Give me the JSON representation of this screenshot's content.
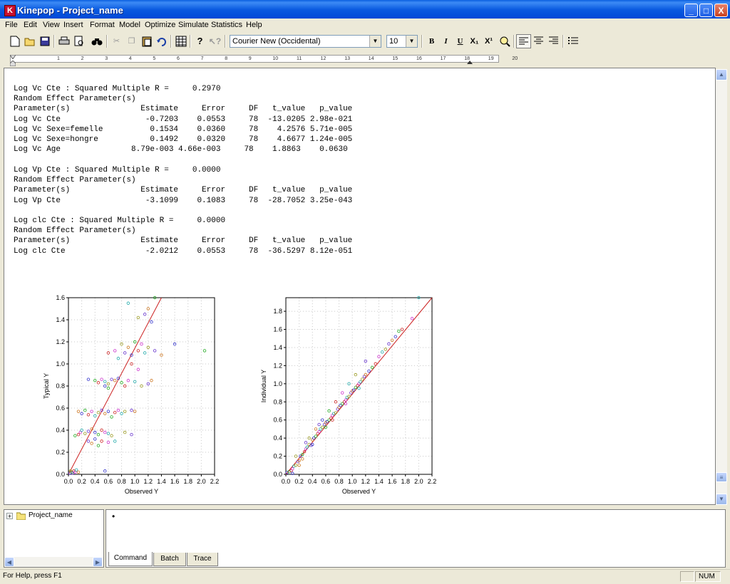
{
  "window": {
    "title": "Kinepop - Project_name",
    "app_icon_letter": "K",
    "minimize": "_",
    "maximize": "□",
    "close": "X"
  },
  "menu": [
    "File",
    "Edit",
    "View",
    "Insert",
    "Format",
    "Model",
    "Optimize",
    "Simulate",
    "Statistics",
    "Help"
  ],
  "toolbar": {
    "font_name": "Courier New (Occidental)",
    "font_size": "10",
    "bold": "B",
    "italic": "I",
    "underline": "U",
    "subscript": "X₁",
    "superscript": "X¹"
  },
  "ruler": {
    "numbers": [
      "1",
      "2",
      "3",
      "4",
      "5",
      "6",
      "7",
      "8",
      "9",
      "10",
      "11",
      "12",
      "13",
      "14",
      "15",
      "16",
      "17",
      "18",
      "19",
      "20"
    ]
  },
  "output": {
    "blocks": [
      {
        "lines": [
          "Log Vc Cte : Squared Multiple R =     0.2970",
          "Random Effect Parameter(s)",
          "Parameter(s)               Estimate     Error     DF   t_value   p_value",
          "Log Vc Cte                  -0.7203    0.0553     78  -13.0205 2.98e-021",
          "Log Vc Sexe=femelle          0.1534    0.0360     78    4.2576 5.71e-005",
          "Log Vc Sexe=hongre           0.1492    0.0320     78    4.6677 1.24e-005",
          "Log Vc Age               8.79e-003 4.66e-003     78    1.8863    0.0630"
        ]
      },
      {
        "lines": [
          "Log Vp Cte : Squared Multiple R =     0.0000",
          "Random Effect Parameter(s)",
          "Parameter(s)               Estimate     Error     DF   t_value   p_value",
          "Log Vp Cte                  -3.1099    0.1083     78  -28.7052 3.25e-043"
        ]
      },
      {
        "lines": [
          "Log clc Cte : Squared Multiple R =     0.0000",
          "Random Effect Parameter(s)",
          "Parameter(s)               Estimate     Error     DF   t_value   p_value",
          "Log clc Cte                 -2.0212    0.0553     78  -36.5297 8.12e-051"
        ]
      }
    ]
  },
  "chart_data": [
    {
      "type": "scatter",
      "xlabel": "Observed Y",
      "ylabel": "Typical Y",
      "xlim": [
        0,
        2.2
      ],
      "ylim": [
        0,
        1.6
      ],
      "xticks": [
        "0.0",
        "0.2",
        "0.4",
        "0.6",
        "0.8",
        "1.0",
        "1.2",
        "1.4",
        "1.6",
        "1.8",
        "2.0",
        "2.2"
      ],
      "yticks": [
        "0.0",
        "0.2",
        "0.4",
        "0.6",
        "0.8",
        "1.0",
        "1.2",
        "1.4",
        "1.6"
      ],
      "reference_line": {
        "from": [
          0,
          0
        ],
        "to": [
          1.4,
          1.6
        ],
        "color": "#cc2222"
      },
      "points": [
        [
          0.02,
          0.01
        ],
        [
          0.05,
          0.02
        ],
        [
          0.08,
          0.03
        ],
        [
          0.1,
          0.02
        ],
        [
          0.12,
          0.04
        ],
        [
          0.03,
          0.03
        ],
        [
          0.06,
          0.01
        ],
        [
          0.15,
          0.02
        ],
        [
          0.55,
          0.03
        ],
        [
          0.1,
          0.35
        ],
        [
          0.15,
          0.36
        ],
        [
          0.18,
          0.38
        ],
        [
          0.2,
          0.4
        ],
        [
          0.25,
          0.37
        ],
        [
          0.3,
          0.39
        ],
        [
          0.35,
          0.41
        ],
        [
          0.4,
          0.38
        ],
        [
          0.45,
          0.36
        ],
        [
          0.5,
          0.4
        ],
        [
          0.55,
          0.38
        ],
        [
          0.6,
          0.37
        ],
        [
          0.65,
          0.35
        ],
        [
          0.3,
          0.3
        ],
        [
          0.35,
          0.28
        ],
        [
          0.4,
          0.32
        ],
        [
          0.45,
          0.26
        ],
        [
          0.5,
          0.3
        ],
        [
          0.6,
          0.29
        ],
        [
          0.7,
          0.3
        ],
        [
          0.85,
          0.38
        ],
        [
          0.95,
          0.36
        ],
        [
          0.15,
          0.57
        ],
        [
          0.2,
          0.55
        ],
        [
          0.25,
          0.58
        ],
        [
          0.3,
          0.54
        ],
        [
          0.35,
          0.57
        ],
        [
          0.4,
          0.53
        ],
        [
          0.45,
          0.56
        ],
        [
          0.5,
          0.58
        ],
        [
          0.55,
          0.55
        ],
        [
          0.6,
          0.57
        ],
        [
          0.65,
          0.52
        ],
        [
          0.7,
          0.56
        ],
        [
          0.75,
          0.58
        ],
        [
          0.8,
          0.55
        ],
        [
          0.85,
          0.57
        ],
        [
          0.95,
          0.58
        ],
        [
          1.0,
          0.57
        ],
        [
          0.3,
          0.86
        ],
        [
          0.4,
          0.85
        ],
        [
          0.45,
          0.83
        ],
        [
          0.5,
          0.86
        ],
        [
          0.55,
          0.84
        ],
        [
          0.6,
          0.82
        ],
        [
          0.65,
          0.86
        ],
        [
          0.7,
          0.85
        ],
        [
          0.75,
          0.87
        ],
        [
          0.8,
          0.83
        ],
        [
          0.85,
          0.8
        ],
        [
          0.9,
          0.85
        ],
        [
          1.0,
          0.84
        ],
        [
          1.1,
          0.8
        ],
        [
          1.2,
          0.82
        ],
        [
          1.25,
          0.85
        ],
        [
          0.55,
          0.8
        ],
        [
          0.6,
          0.78
        ],
        [
          0.6,
          1.1
        ],
        [
          0.7,
          1.12
        ],
        [
          0.75,
          1.05
        ],
        [
          0.8,
          1.18
        ],
        [
          0.85,
          1.1
        ],
        [
          0.9,
          1.15
        ],
        [
          0.95,
          1.08
        ],
        [
          1.0,
          1.2
        ],
        [
          1.05,
          1.12
        ],
        [
          1.1,
          1.18
        ],
        [
          1.15,
          1.1
        ],
        [
          1.2,
          1.15
        ],
        [
          1.3,
          1.12
        ],
        [
          1.4,
          1.08
        ],
        [
          1.6,
          1.18
        ],
        [
          2.05,
          1.12
        ],
        [
          0.95,
          1.0
        ],
        [
          1.05,
          0.95
        ],
        [
          0.9,
          1.55
        ],
        [
          1.05,
          1.42
        ],
        [
          1.15,
          1.45
        ],
        [
          1.2,
          1.5
        ],
        [
          1.25,
          1.38
        ],
        [
          1.3,
          1.6
        ]
      ]
    },
    {
      "type": "scatter",
      "xlabel": "Observed Y",
      "ylabel": "Individual Y",
      "xlim": [
        0,
        2.2
      ],
      "ylim": [
        0,
        1.95
      ],
      "xticks": [
        "0.0",
        "0.2",
        "0.4",
        "0.6",
        "0.8",
        "1.0",
        "1.2",
        "1.4",
        "1.6",
        "1.8",
        "2.0",
        "2.2"
      ],
      "yticks": [
        "0.0",
        "0.2",
        "0.4",
        "0.6",
        "0.8",
        "1.0",
        "1.2",
        "1.4",
        "1.6",
        "1.8"
      ],
      "reference_line": {
        "from": [
          0,
          0
        ],
        "to": [
          2.2,
          1.95
        ],
        "color": "#cc2222"
      },
      "points": [
        [
          0.02,
          0.02
        ],
        [
          0.05,
          0.03
        ],
        [
          0.08,
          0.04
        ],
        [
          0.1,
          0.06
        ],
        [
          0.12,
          0.09
        ],
        [
          0.15,
          0.1
        ],
        [
          0.18,
          0.14
        ],
        [
          0.2,
          0.15
        ],
        [
          0.22,
          0.2
        ],
        [
          0.25,
          0.22
        ],
        [
          0.28,
          0.25
        ],
        [
          0.3,
          0.28
        ],
        [
          0.32,
          0.3
        ],
        [
          0.35,
          0.33
        ],
        [
          0.38,
          0.32
        ],
        [
          0.4,
          0.38
        ],
        [
          0.42,
          0.4
        ],
        [
          0.45,
          0.42
        ],
        [
          0.48,
          0.45
        ],
        [
          0.5,
          0.47
        ],
        [
          0.52,
          0.5
        ],
        [
          0.55,
          0.52
        ],
        [
          0.58,
          0.55
        ],
        [
          0.6,
          0.57
        ],
        [
          0.62,
          0.58
        ],
        [
          0.65,
          0.6
        ],
        [
          0.68,
          0.62
        ],
        [
          0.7,
          0.65
        ],
        [
          0.72,
          0.67
        ],
        [
          0.75,
          0.68
        ],
        [
          0.78,
          0.72
        ],
        [
          0.8,
          0.74
        ],
        [
          0.82,
          0.76
        ],
        [
          0.85,
          0.78
        ],
        [
          0.88,
          0.8
        ],
        [
          0.9,
          0.82
        ],
        [
          0.92,
          0.85
        ],
        [
          0.95,
          0.86
        ],
        [
          0.98,
          0.9
        ],
        [
          1.0,
          0.92
        ],
        [
          1.02,
          0.93
        ],
        [
          1.05,
          0.96
        ],
        [
          1.08,
          0.98
        ],
        [
          1.1,
          1.0
        ],
        [
          1.12,
          1.02
        ],
        [
          1.15,
          1.05
        ],
        [
          1.18,
          1.08
        ],
        [
          1.2,
          1.1
        ],
        [
          1.25,
          1.14
        ],
        [
          1.3,
          1.18
        ],
        [
          1.35,
          1.22
        ],
        [
          1.4,
          1.3
        ],
        [
          1.45,
          1.35
        ],
        [
          1.5,
          1.38
        ],
        [
          1.55,
          1.44
        ],
        [
          1.6,
          1.48
        ],
        [
          1.65,
          1.52
        ],
        [
          1.7,
          1.58
        ],
        [
          1.75,
          1.6
        ],
        [
          1.9,
          1.72
        ],
        [
          2.0,
          1.95
        ],
        [
          0.15,
          0.2
        ],
        [
          0.3,
          0.35
        ],
        [
          0.45,
          0.5
        ],
        [
          0.55,
          0.6
        ],
        [
          0.65,
          0.7
        ],
        [
          0.75,
          0.8
        ],
        [
          0.85,
          0.9
        ],
        [
          0.95,
          1.0
        ],
        [
          1.05,
          1.1
        ],
        [
          1.2,
          1.25
        ],
        [
          0.25,
          0.17
        ],
        [
          0.4,
          0.33
        ],
        [
          0.6,
          0.52
        ],
        [
          0.7,
          0.6
        ],
        [
          0.9,
          0.78
        ],
        [
          1.1,
          0.95
        ],
        [
          0.35,
          0.4
        ],
        [
          0.5,
          0.55
        ],
        [
          0.2,
          0.1
        ],
        [
          0.1,
          0.01
        ]
      ]
    }
  ],
  "point_colors": [
    "#3333cc",
    "#22aa22",
    "#cc2222",
    "#cc33cc",
    "#22aaaa",
    "#999922",
    "#6633cc",
    "#cc7722"
  ],
  "tree": {
    "root": "Project_name",
    "expander": "+"
  },
  "command": {
    "bullet": "•",
    "tabs": [
      "Command",
      "Batch",
      "Trace"
    ]
  },
  "status": {
    "help": "For Help, press F1",
    "num": "NUM"
  }
}
